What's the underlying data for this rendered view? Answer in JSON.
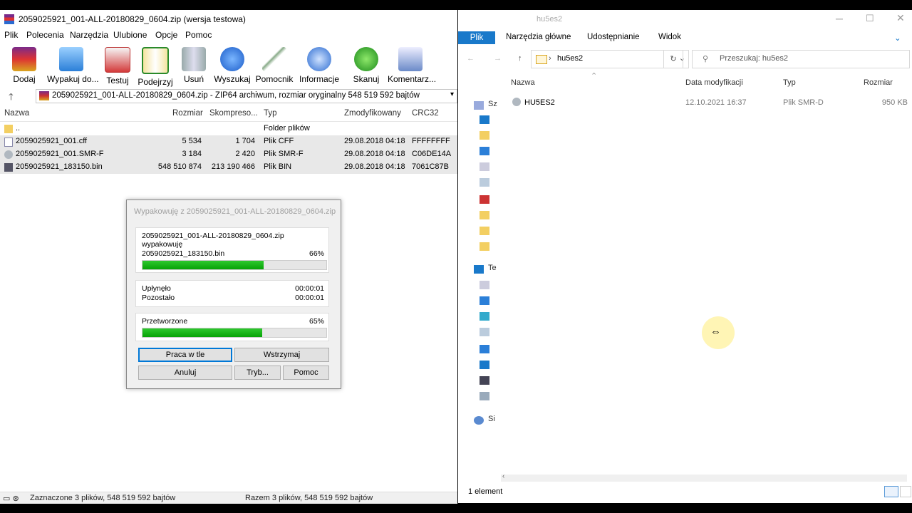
{
  "winrar": {
    "title": "2059025921_001-ALL-20180829_0604.zip (wersja testowa)",
    "menu": [
      "Plik",
      "Polecenia",
      "Narzędzia",
      "Ulubione",
      "Opcje",
      "Pomoc"
    ],
    "toolbar": [
      "Dodaj",
      "Wypakuj do...",
      "Testuj",
      "Podejrzyj",
      "Usuń",
      "Wyszukaj",
      "Pomocnik",
      "Informacje",
      "Skanuj",
      "Komentarz..."
    ],
    "path": "2059025921_001-ALL-20180829_0604.zip - ZIP64 archiwum, rozmiar oryginalny 548 519 592 bajtów",
    "columns": [
      "Nazwa",
      "Rozmiar",
      "Skompreso...",
      "Typ",
      "Zmodyfikowany",
      "CRC32"
    ],
    "rows": [
      {
        "name": "..",
        "size": "",
        "packed": "",
        "type": "Folder plików",
        "modified": "",
        "crc": ""
      },
      {
        "name": "2059025921_001.cff",
        "size": "5 534",
        "packed": "1 704",
        "type": "Plik CFF",
        "modified": "29.08.2018 04:18",
        "crc": "FFFFFFFF"
      },
      {
        "name": "2059025921_001.SMR-F",
        "size": "3 184",
        "packed": "2 420",
        "type": "Plik SMR-F",
        "modified": "29.08.2018 04:18",
        "crc": "C06DE14A"
      },
      {
        "name": "2059025921_183150.bin",
        "size": "548 510 874",
        "packed": "213 190 466",
        "type": "Plik BIN",
        "modified": "29.08.2018 04:18",
        "crc": "7061C87B"
      }
    ],
    "status_left": "Zaznaczone 3 plików, 548 519 592 bajtów",
    "status_right": "Razem 3 plików, 548 519 592 bajtów"
  },
  "dialog": {
    "title": "Wypakowuję z 2059025921_001-ALL-20180829_0604.zip",
    "archive": "2059025921_001-ALL-20180829_0604.zip",
    "action": "wypakowuję",
    "file": "2059025921_183150.bin",
    "file_percent": "66%",
    "file_progress": 0.66,
    "elapsed_label": "Upłynęło",
    "elapsed": "00:00:01",
    "remaining_label": "Pozostało",
    "remaining": "00:00:01",
    "processed_label": "Przetworzone",
    "processed_percent": "65%",
    "processed_progress": 0.65,
    "buttons": {
      "background": "Praca w tle",
      "pause": "Wstrzymaj",
      "cancel": "Anuluj",
      "mode": "Tryb...",
      "help": "Pomoc"
    }
  },
  "explorer": {
    "title": "hu5es2",
    "ribbon": [
      "Plik",
      "Narzędzia główne",
      "Udostępnianie",
      "Widok"
    ],
    "address": "hu5es2",
    "search_placeholder": "Przeszukaj: hu5es2",
    "columns": [
      "Nazwa",
      "Data modyfikacji",
      "Typ",
      "Rozmiar"
    ],
    "file": {
      "name": "HU5ES2",
      "modified": "12.10.2021 16:37",
      "type": "Plik SMR-D",
      "size": "950 KB"
    },
    "nav_labels": [
      "Sz",
      "Te",
      "Si"
    ],
    "status": "1 element"
  }
}
